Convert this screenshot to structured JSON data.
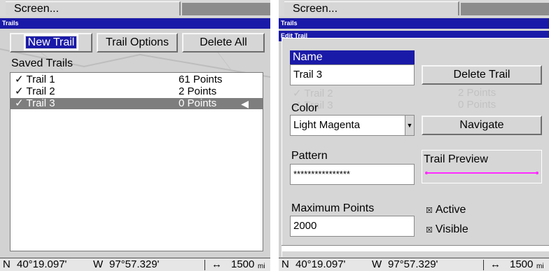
{
  "left": {
    "screen_menu": "Screen...",
    "title": "Trails",
    "buttons": {
      "new_trail": "New Trail",
      "trail_options": "Trail Options",
      "delete_all": "Delete All"
    },
    "saved_trails_label": "Saved Trails",
    "trails": [
      {
        "check": "✓",
        "name": "Trail 1",
        "points": "61 Points"
      },
      {
        "check": "✓",
        "name": "Trail 2",
        "points": "2 Points"
      },
      {
        "check": "✓",
        "name": "Trail 3",
        "points": "0 Points",
        "selected": true
      }
    ],
    "selected_arrow_icon": "arrow-left-icon",
    "status": {
      "lat_dir": "N",
      "lat": "40°19.097'",
      "lon_dir": "W",
      "lon": "97°57.329'",
      "scale_icon": "↔",
      "scale": "1500",
      "unit": "mi"
    }
  },
  "right": {
    "screen_menu": "Screen...",
    "title": "Trails",
    "dialog_title": "Edit Trail",
    "name_label": "Name",
    "name_value": "Trail 3",
    "delete_trail": "Delete Trail",
    "color_label": "Color",
    "color_value": "Light Magenta",
    "navigate": "Navigate",
    "pattern_label": "Pattern",
    "pattern_value": "****************",
    "trail_preview_label": "Trail Preview",
    "trail_preview_color": "#ff2bff",
    "max_points_label": "Maximum Points",
    "max_points_value": "2000",
    "active_label": "Active",
    "active_checked": true,
    "visible_label": "Visible",
    "visible_checked": true,
    "ghost_rows": [
      {
        "name": "✓ Trail 2",
        "points": "2 Points"
      },
      {
        "name": "✓ Trail 3",
        "points": "0 Points"
      }
    ],
    "status": {
      "lat_dir": "N",
      "lat": "40°19.097'",
      "lon_dir": "W",
      "lon": "97°57.329'",
      "scale_icon": "↔",
      "scale": "1500",
      "unit": "mi"
    }
  },
  "colors": {
    "title_bar": "#1a1aa8",
    "selected_row": "#7e7e7e",
    "panel": "#d2d2d2"
  }
}
